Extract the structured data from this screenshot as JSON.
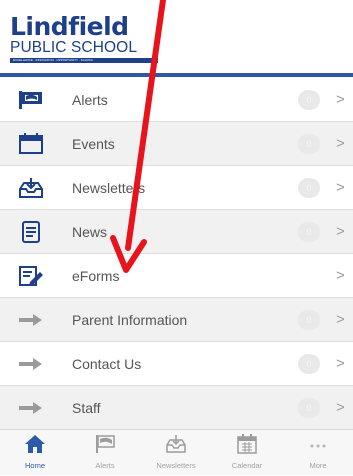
{
  "header": {
    "logo_main": "Lindfield",
    "logo_sub": "PUBLIC SCHOOL",
    "logo_strip": "EXCELLENCE · INNOVATION · OPPORTUNITY · SCHOOL",
    "brand_color": "#1e3f8a",
    "accent_color": "#2d5aa6"
  },
  "menu": {
    "items": [
      {
        "label": "Alerts",
        "icon": "flag-icon",
        "badge": "0"
      },
      {
        "label": "Events",
        "icon": "calendar-icon",
        "badge": "0"
      },
      {
        "label": "Newsletters",
        "icon": "newsletter-tray-icon",
        "badge": "0"
      },
      {
        "label": "News",
        "icon": "document-icon",
        "badge": "0"
      },
      {
        "label": "eForms",
        "icon": "form-pen-icon",
        "badge": ""
      },
      {
        "label": "Parent Information",
        "icon": "arrow-right-icon",
        "badge": "0"
      },
      {
        "label": "Contact Us",
        "icon": "arrow-right-icon",
        "badge": "0"
      },
      {
        "label": "Staff",
        "icon": "arrow-right-icon",
        "badge": "0"
      }
    ],
    "chevron": ">"
  },
  "tabbar": {
    "tabs": [
      {
        "label": "Home",
        "icon": "home-icon"
      },
      {
        "label": "Alerts",
        "icon": "flag-icon"
      },
      {
        "label": "Newsletters",
        "icon": "newsletter-tray-icon"
      },
      {
        "label": "Calendar",
        "icon": "calendar-grid-icon"
      },
      {
        "label": "More",
        "icon": "more-dots-icon"
      }
    ]
  },
  "annotation": {
    "color": "#e8141b",
    "shape": "red-arrow-pointing-down"
  }
}
